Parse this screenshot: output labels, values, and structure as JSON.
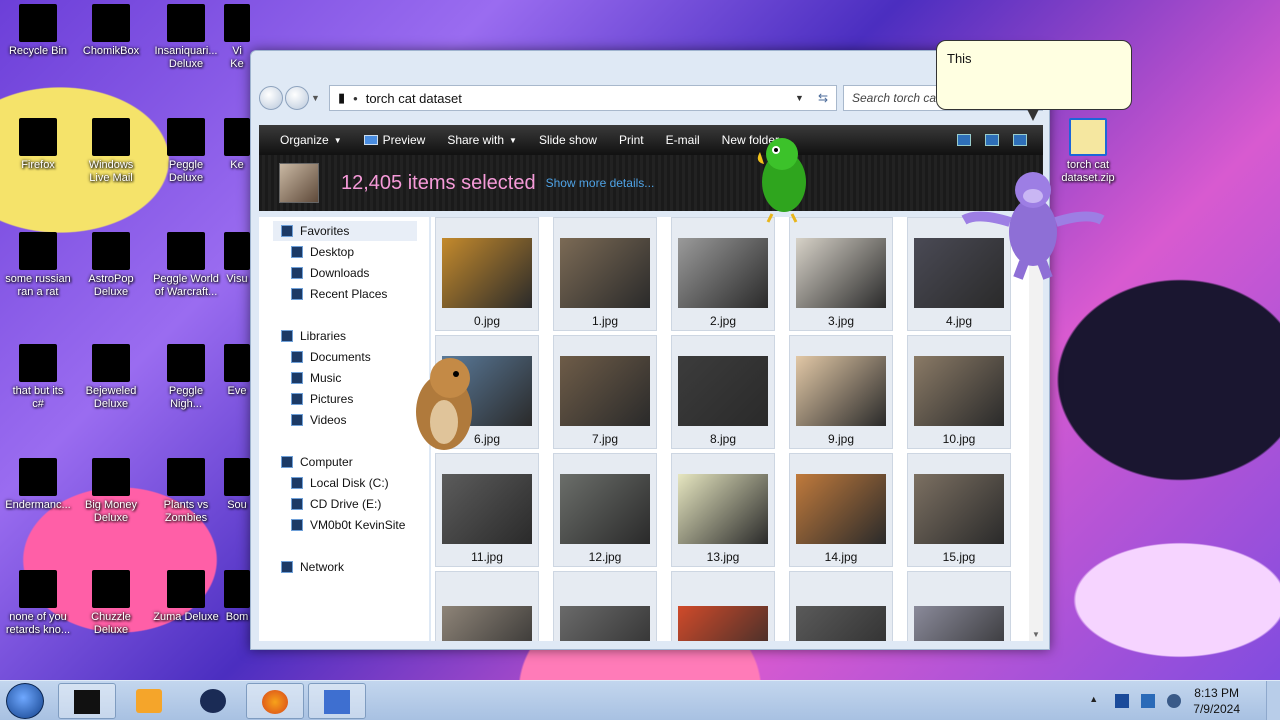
{
  "desktop": {
    "icons": [
      {
        "label": "Recycle Bin"
      },
      {
        "label": "ChomikBox"
      },
      {
        "label": "Insaniquari...\nDeluxe"
      },
      {
        "label": "Firefox"
      },
      {
        "label": "Windows\nLive Mail"
      },
      {
        "label": "Peggle\nDeluxe"
      },
      {
        "label": "some russian\nran a rat"
      },
      {
        "label": "AstroPop\nDeluxe"
      },
      {
        "label": "Peggle World\nof Warcraft..."
      },
      {
        "label": "that but its\nc#"
      },
      {
        "label": "Bejeweled\nDeluxe"
      },
      {
        "label": "Peggle\nNigh..."
      },
      {
        "label": "Endermanc..."
      },
      {
        "label": "Big Money\nDeluxe"
      },
      {
        "label": "Plants vs\nZombies"
      },
      {
        "label": "none of you\nretards kno..."
      },
      {
        "label": "Chuzzle\nDeluxe"
      },
      {
        "label": "Zuma Deluxe"
      },
      {
        "label": "torch cat\ndataset.zip"
      }
    ],
    "partial_labels": [
      "Vi\nKe",
      "Ke",
      "Visu",
      "Eve",
      "Sou",
      "Bom"
    ]
  },
  "explorer": {
    "address": {
      "crumb": "torch cat dataset"
    },
    "search_placeholder": "Search torch cat dataset",
    "commands": {
      "organize": "Organize",
      "preview": "Preview",
      "share_with": "Share with",
      "slide_show": "Slide show",
      "print": "Print",
      "email": "E-mail",
      "new_folder": "New folder"
    },
    "details": {
      "selected_count": "12,405 items selected",
      "show_more": "Show more details..."
    },
    "nav": {
      "favorites": "Favorites",
      "desktop": "Desktop",
      "downloads": "Downloads",
      "recent_places": "Recent Places",
      "libraries": "Libraries",
      "documents": "Documents",
      "music": "Music",
      "pictures": "Pictures",
      "videos": "Videos",
      "computer": "Computer",
      "local_disk": "Local Disk (C:)",
      "cd_drive": "CD Drive (E:)",
      "vm_drive": "VM0b0t KevinSite",
      "network": "Network"
    },
    "files": [
      {
        "name": "0.jpg",
        "color": "#c48a2c"
      },
      {
        "name": "1.jpg",
        "color": "#7b6a55"
      },
      {
        "name": "2.jpg",
        "color": "#9a9a9a"
      },
      {
        "name": "3.jpg",
        "color": "#d7d2c8"
      },
      {
        "name": "4.jpg",
        "color": "#4a4a55"
      },
      {
        "name": "6.jpg",
        "color": "#5a7a9a"
      },
      {
        "name": "7.jpg",
        "color": "#6e5c48"
      },
      {
        "name": "8.jpg",
        "color": "#3c3c3c"
      },
      {
        "name": "9.jpg",
        "color": "#e2c8a6"
      },
      {
        "name": "10.jpg",
        "color": "#8a7a66"
      },
      {
        "name": "11.jpg",
        "color": "#5c5c5c"
      },
      {
        "name": "12.jpg",
        "color": "#6b6e6a"
      },
      {
        "name": "13.jpg",
        "color": "#e6e6c0"
      },
      {
        "name": "14.jpg",
        "color": "#c07a3c"
      },
      {
        "name": "15.jpg",
        "color": "#7c7062"
      },
      {
        "name": "",
        "color": "#8e8478"
      },
      {
        "name": "",
        "color": "#6a6a6a"
      },
      {
        "name": "",
        "color": "#d04a2a"
      },
      {
        "name": "",
        "color": "#5a5a5a"
      },
      {
        "name": "",
        "color": "#8a8a9a"
      }
    ]
  },
  "tooltip": {
    "text": "This"
  },
  "taskbar": {
    "time": "8:13 PM",
    "date": "7/9/2024"
  },
  "colors": {
    "selection_text": "#f59ad8",
    "link": "#4fa3e6"
  }
}
